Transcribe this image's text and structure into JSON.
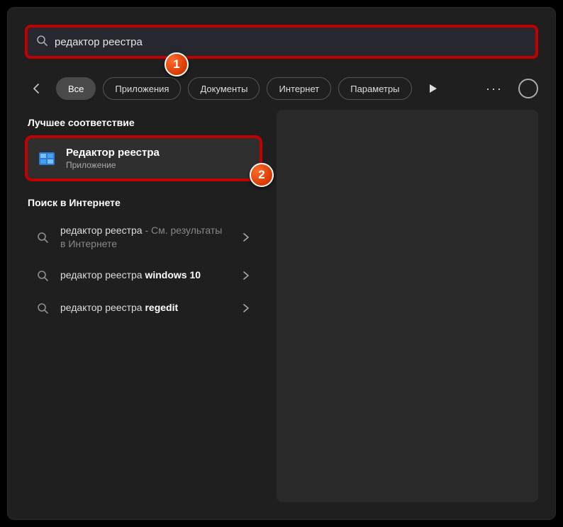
{
  "search": {
    "value": "редактор реестра"
  },
  "filters": {
    "all": "Все",
    "apps": "Приложения",
    "documents": "Документы",
    "web": "Интернет",
    "settings": "Параметры"
  },
  "sections": {
    "best_match": "Лучшее соответствие",
    "web_search": "Поиск в Интернете"
  },
  "best_result": {
    "name": "Редактор реестра",
    "type": "Приложение"
  },
  "suggestions": [
    {
      "prefix": "редактор реестра",
      "suffix": " - См. результаты в Интернете",
      "bold": ""
    },
    {
      "prefix": "редактор реестра ",
      "suffix": "",
      "bold": "windows 10"
    },
    {
      "prefix": "редактор реестра ",
      "suffix": "",
      "bold": "regedit"
    }
  ],
  "markers": {
    "one": "1",
    "two": "2"
  }
}
